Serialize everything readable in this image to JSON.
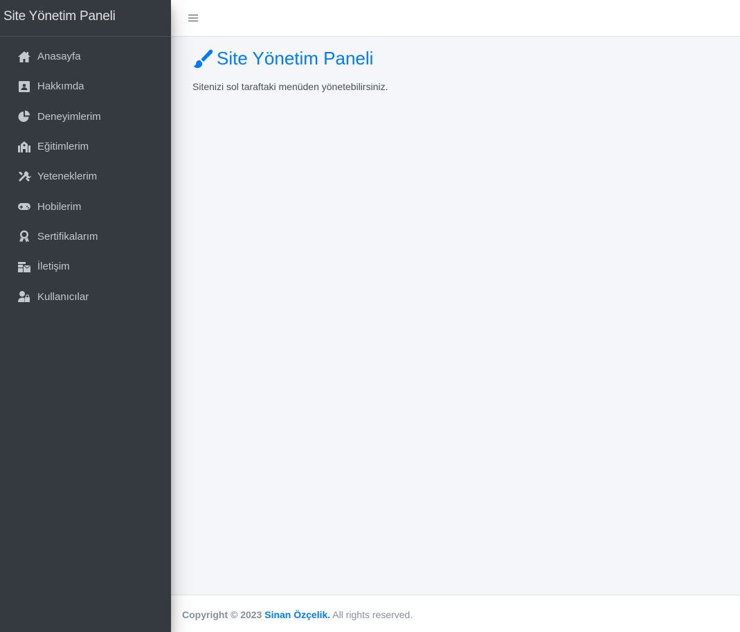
{
  "sidebar": {
    "brand": "Site Yönetim Paneli",
    "items": [
      {
        "label": "Anasayfa",
        "icon": "home-icon"
      },
      {
        "label": "Hakkımda",
        "icon": "address-card-icon"
      },
      {
        "label": "Deneyimlerim",
        "icon": "chart-pie-icon"
      },
      {
        "label": "Eğitimlerim",
        "icon": "school-icon"
      },
      {
        "label": "Yeteneklerim",
        "icon": "tools-icon"
      },
      {
        "label": "Hobilerim",
        "icon": "gamepad-icon"
      },
      {
        "label": "Sertifikalarım",
        "icon": "award-icon"
      },
      {
        "label": "İletişim",
        "icon": "mail-bulk-icon"
      },
      {
        "label": "Kullanıcılar",
        "icon": "user-lock-icon"
      }
    ]
  },
  "topbar": {
    "toggle_icon": "bars-icon"
  },
  "main": {
    "title": "Site Yönetim Paneli",
    "title_icon": "paint-brush-icon",
    "text": "Sitenizi sol taraftaki menüden yönetebilirsiniz."
  },
  "footer": {
    "prefix": "Copyright © 2023",
    "author": "Sinan Özçelik.",
    "suffix": "All rights reserved."
  },
  "colors": {
    "sidebar_bg": "#343a40",
    "accent": "#007bff",
    "content_bg": "#f4f6f9"
  }
}
